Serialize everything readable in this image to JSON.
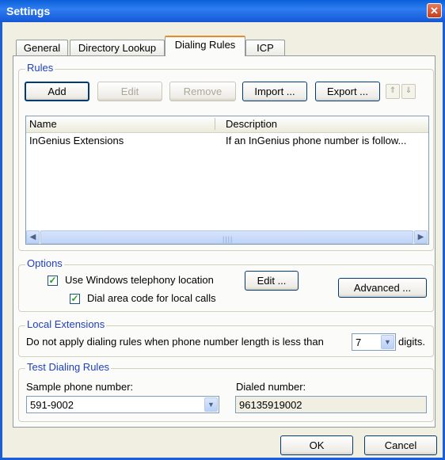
{
  "window": {
    "title": "Settings",
    "close_glyph": "✕"
  },
  "tabs": [
    {
      "label": "General"
    },
    {
      "label": "Directory Lookup"
    },
    {
      "label": "Dialing Rules"
    },
    {
      "label": "ICP"
    }
  ],
  "rules": {
    "legend": "Rules",
    "buttons": {
      "add": "Add",
      "edit": "Edit",
      "remove": "Remove",
      "import": "Import ...",
      "export": "Export ..."
    },
    "move_up_glyph": "⇑",
    "move_down_glyph": "⇓",
    "columns": {
      "name": "Name",
      "description": "Description"
    },
    "rows": [
      {
        "name": "InGenius Extensions",
        "description": "If an InGenius phone number is follow..."
      }
    ],
    "scroll_left_glyph": "◀",
    "scroll_right_glyph": "▶",
    "scroll_grip": "||||"
  },
  "options": {
    "legend": "Options",
    "use_windows_location": {
      "label": "Use Windows telephony location",
      "checked": true
    },
    "dial_area_code": {
      "label": "Dial area code for local calls",
      "checked": true
    },
    "edit_button": "Edit ...",
    "advanced_button": "Advanced ...",
    "check_glyph": "✓"
  },
  "local_extensions": {
    "legend": "Local Extensions",
    "prefix": "Do not apply dialing rules when phone number length is less than",
    "value": "7",
    "suffix": "digits."
  },
  "test": {
    "legend": "Test Dialing Rules",
    "sample_label": "Sample phone number:",
    "sample_value": "591-9002",
    "dialed_label": "Dialed number:",
    "dialed_value": "96135919002"
  },
  "footer": {
    "ok": "OK",
    "cancel": "Cancel"
  },
  "dropdown_glyph": "▼",
  "colors": {
    "title_bar": "#1457d6",
    "legend_text": "#1f40c0",
    "active_tab_accent": "#e68b2c"
  }
}
